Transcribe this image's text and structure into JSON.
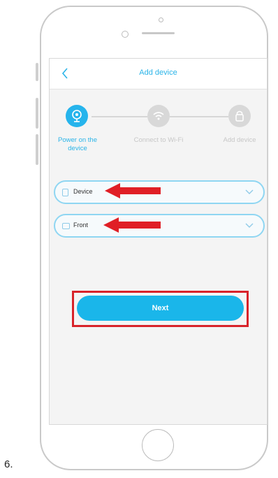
{
  "header": {
    "back_icon": "back-chevron-icon",
    "title": "Add device"
  },
  "stepper": {
    "steps": [
      {
        "label": "Power on the device",
        "icon": "camera-icon",
        "active": true
      },
      {
        "label": "Connect to Wi-Fi",
        "icon": "wifi-icon",
        "active": false
      },
      {
        "label": "Add device",
        "icon": "lock-icon",
        "active": false
      }
    ]
  },
  "fields": {
    "device": {
      "value": "Device",
      "icon": "device-icon"
    },
    "position": {
      "value": "Front",
      "icon": "monitor-icon"
    }
  },
  "actions": {
    "next_label": "Next"
  },
  "annotation": {
    "step_number": "6."
  },
  "colors": {
    "accent": "#26b4ec",
    "highlight": "#d8232a",
    "inactive": "#d8d8d8"
  }
}
